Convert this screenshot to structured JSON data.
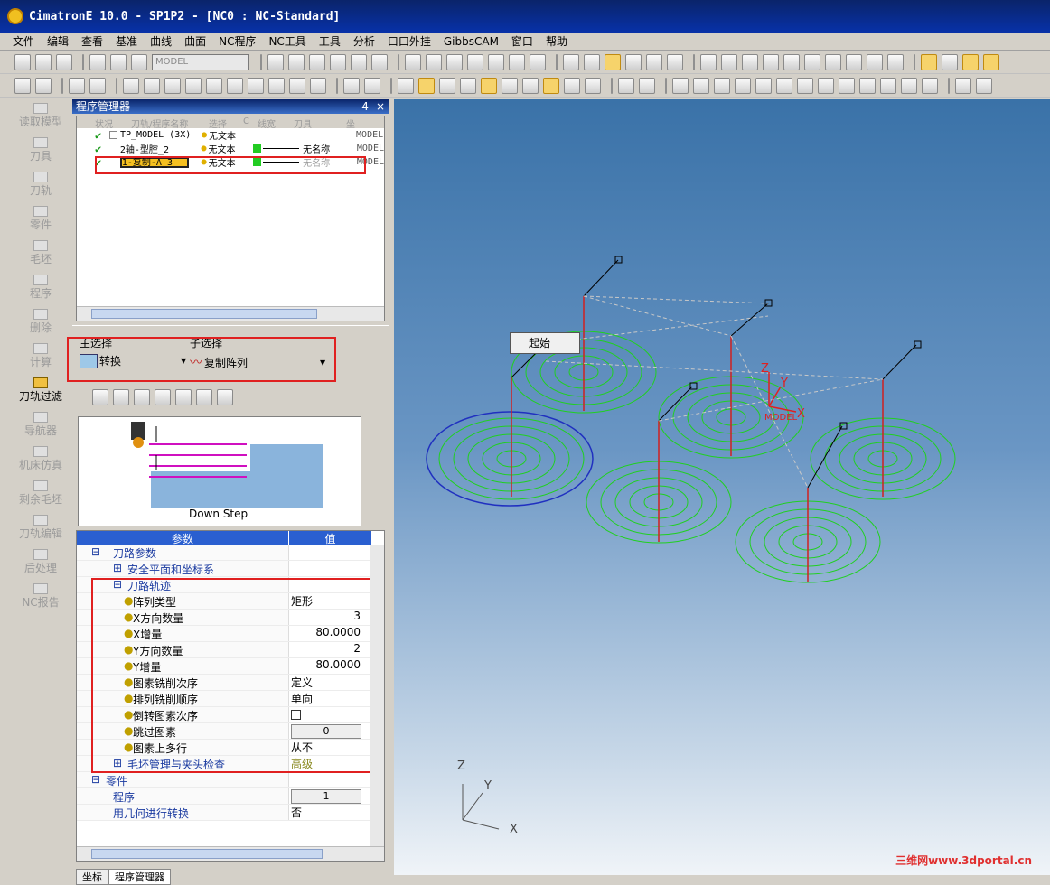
{
  "window": {
    "title": "CimatronE 10.0 - SP1P2 - [NC0 : NC-Standard]"
  },
  "menu": [
    "文件",
    "编辑",
    "查看",
    "基准",
    "曲线",
    "曲面",
    "NC程序",
    "NC工具",
    "工具",
    "分析",
    "口口外挂",
    "GibbsCAM",
    "窗口",
    "帮助"
  ],
  "toolbar": {
    "model_combo": "MODEL"
  },
  "sidebar": {
    "items": [
      "读取模型",
      "刀具",
      "刀轨",
      "零件",
      "毛坯",
      "程序",
      "删除",
      "计算",
      "刀轨过滤",
      "导航器",
      "机床仿真",
      "剩余毛坯",
      "刀轨编辑",
      "后处理",
      "NC报告"
    ],
    "active_index": 8
  },
  "program_manager": {
    "title": "程序管理器",
    "pin": "4",
    "close": "×",
    "columns": [
      "状况",
      "刀轨/程序名称",
      "选择",
      "C",
      "线宽",
      "刀具",
      "坐"
    ],
    "rows": [
      {
        "name": "TP_MODEL (3X)",
        "text": "无文本",
        "tool": "",
        "model": "MODEL"
      },
      {
        "name": "2轴-型腔_2",
        "text": "无文本",
        "tool": "无名称",
        "model": "MODEL"
      },
      {
        "name": "1-复制-A_3",
        "text": "无文本",
        "tool": "无名称",
        "model": "MODEL"
      }
    ]
  },
  "selection": {
    "main_label": "主选择",
    "sub_label": "子选择",
    "main_value": "转换",
    "sub_value": "复制阵列"
  },
  "preview": {
    "caption": "Down Step"
  },
  "params": {
    "header": {
      "col1": "参数",
      "col2": "值"
    },
    "rows": [
      {
        "label": "刀路参数",
        "value": "",
        "indent": 0
      },
      {
        "label": "安全平面和坐标系",
        "value": "",
        "indent": 1
      },
      {
        "label": "刀路轨迹",
        "value": "",
        "indent": 1
      },
      {
        "label": "阵列类型",
        "value": "矩形",
        "indent": 2
      },
      {
        "label": "X方向数量",
        "value": "3",
        "indent": 2
      },
      {
        "label": "X增量",
        "value": "80.0000",
        "indent": 2
      },
      {
        "label": "Y方向数量",
        "value": "2",
        "indent": 2
      },
      {
        "label": "Y增量",
        "value": "80.0000",
        "indent": 2
      },
      {
        "label": "图素铣削次序",
        "value": "定义",
        "indent": 2
      },
      {
        "label": "排列铣削顺序",
        "value": "单向",
        "indent": 2
      },
      {
        "label": "倒转图素次序",
        "value": "",
        "indent": 2
      },
      {
        "label": "跳过图素",
        "value": "0",
        "indent": 2
      },
      {
        "label": "图素上多行",
        "value": "从不",
        "indent": 2
      },
      {
        "label": "毛坯管理与夹头检查",
        "value": "高级",
        "indent": 1
      },
      {
        "label": "零件",
        "value": "",
        "indent": 0
      },
      {
        "label": "程序",
        "value": "1",
        "indent": 1
      },
      {
        "label": "用几何进行转换",
        "value": "否",
        "indent": 1
      }
    ]
  },
  "bottom_tabs": [
    "坐标",
    "程序管理器"
  ],
  "viewport": {
    "start_label": "起始",
    "axis_z": "Z",
    "axis_y": "Y",
    "axis_x": "X",
    "model_label": "MODEL",
    "watermark": "三维网www.3dportal.cn"
  }
}
